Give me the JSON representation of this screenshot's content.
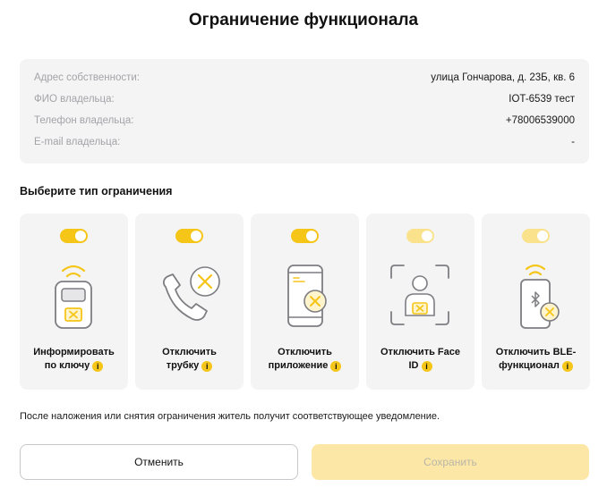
{
  "title": "Ограничение функционала",
  "owner_info": [
    {
      "label": "Адрес собственности:",
      "value": "улица Гончарова, д. 23Б, кв. 6"
    },
    {
      "label": "ФИО владельца:",
      "value": "IOT-6539 тест"
    },
    {
      "label": "Телефон владельца:",
      "value": "+78006539000"
    },
    {
      "label": "E-mail владельца:",
      "value": "-"
    }
  ],
  "section_title": "Выберите тип ограничения",
  "cards": [
    {
      "label_line1": "Информировать",
      "label_line2": "по ключу",
      "icon": "key-tag-icon",
      "toggle_on": true
    },
    {
      "label_line1": "Отключить",
      "label_line2": "трубку",
      "icon": "handset-icon",
      "toggle_on": true
    },
    {
      "label_line1": "Отключить",
      "label_line2": "приложение",
      "icon": "phone-app-icon",
      "toggle_on": true
    },
    {
      "label_line1": "Отключить Face",
      "label_line2": "ID",
      "icon": "face-id-icon",
      "toggle_on": true
    },
    {
      "label_line1": "Отключить BLE-",
      "label_line2": "функционал",
      "icon": "bluetooth-phone-icon",
      "toggle_on": true
    }
  ],
  "info_badge": "i",
  "note": "После наложения или снятия ограничения житель получит соответствующее уведомление.",
  "buttons": {
    "cancel": "Отменить",
    "save": "Сохранить"
  },
  "colors": {
    "accent": "#f5c518",
    "accent_light": "#fae28c",
    "save_disabled_bg": "#fde7a6"
  }
}
